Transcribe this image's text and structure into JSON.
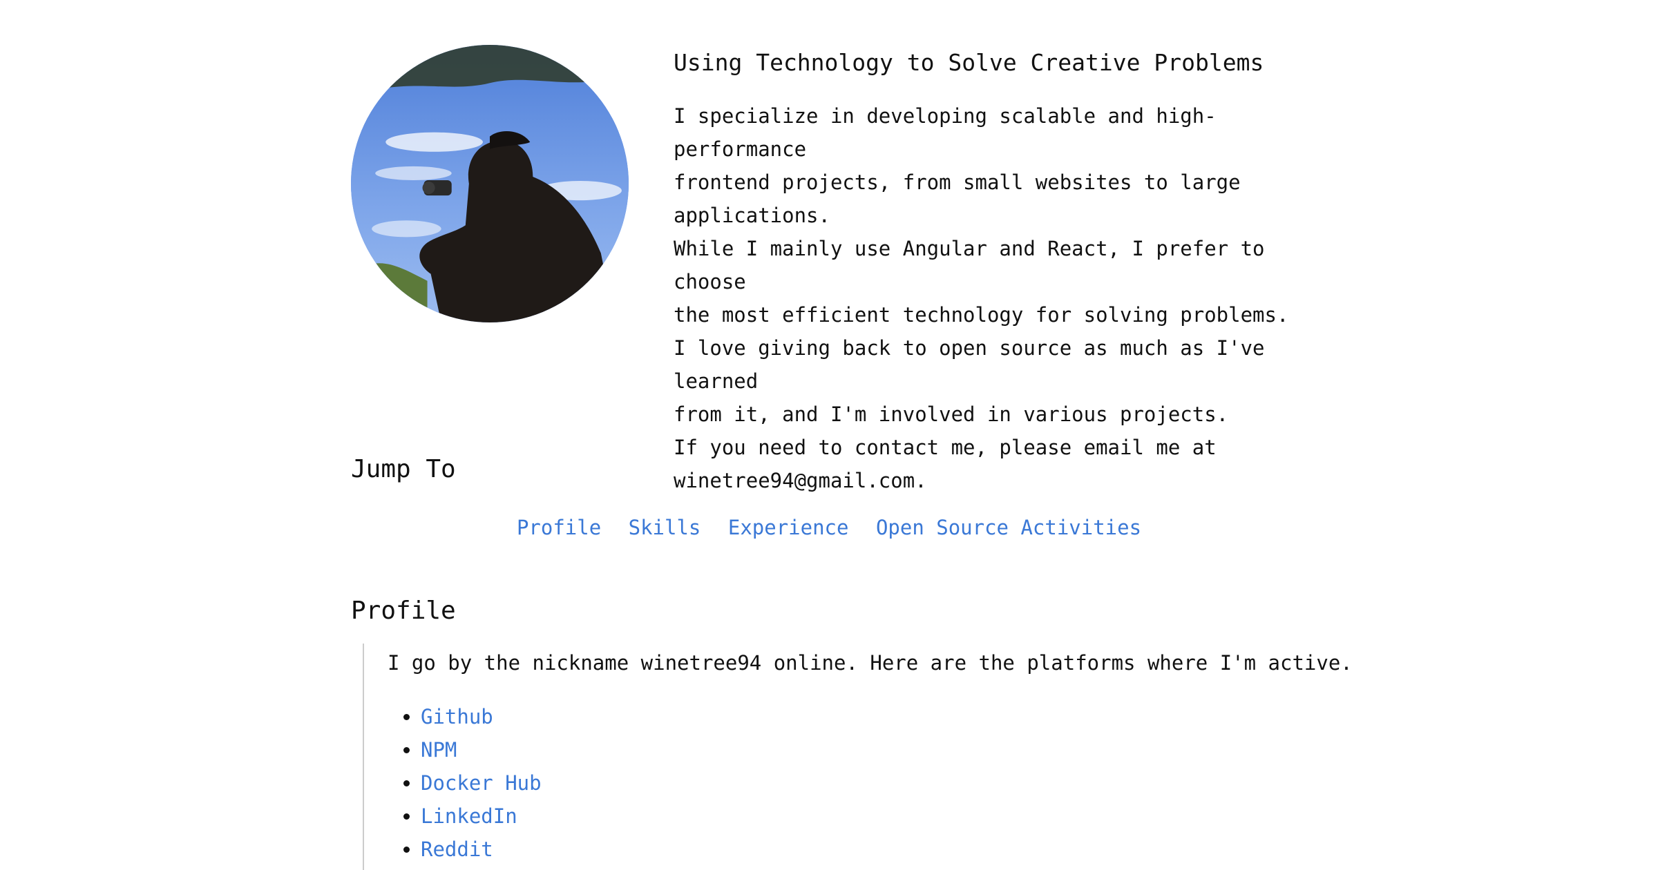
{
  "hero": {
    "title": "Using Technology to Solve Creative Problems",
    "paragraph_lines": [
      "I specialize in developing scalable and high-performance",
      "frontend projects, from small websites to large",
      "applications.",
      "While I mainly use Angular and React, I prefer to choose",
      "the most efficient technology for solving problems.",
      "I love giving back to open source as much as I've learned",
      "from it, and I'm involved in various projects.",
      "If you need to contact me, please email me at",
      "winetree94@gmail.com."
    ]
  },
  "jump": {
    "heading": "Jump To",
    "links": [
      "Profile",
      "Skills",
      "Experience",
      "Open Source Activities"
    ]
  },
  "profile": {
    "heading": "Profile",
    "intro": "I go by the nickname winetree94 online. Here are the platforms where I'm active.",
    "platforms": [
      "Github",
      "NPM",
      "Docker Hub",
      "LinkedIn",
      "Reddit"
    ]
  },
  "colors": {
    "link": "#3a78d6",
    "text": "#111111",
    "quote_border": "#cccccc"
  }
}
